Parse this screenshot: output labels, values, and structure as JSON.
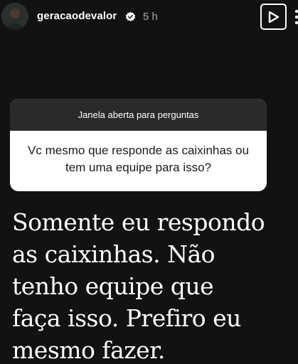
{
  "header": {
    "username": "geracaodevalor",
    "verified_icon": "verified-badge-icon",
    "time_ago": "5 h",
    "play_icon": "play-icon",
    "more_icon": "more-options-icon"
  },
  "question_sticker": {
    "title": "Janela aberta para perguntas",
    "question": "Vc mesmo que responde as caixinhas ou tem uma equipe para isso?"
  },
  "answer": {
    "text": "Somente eu respondo\nas caixinhas. Não\ntenho equipe que\nfaça isso. Prefiro eu\nmesmo fazer."
  },
  "colors": {
    "background": "#121212",
    "sticker_header": "#2a2a2a",
    "sticker_body": "#ffffff",
    "timestamp": "#a8a8a8"
  }
}
